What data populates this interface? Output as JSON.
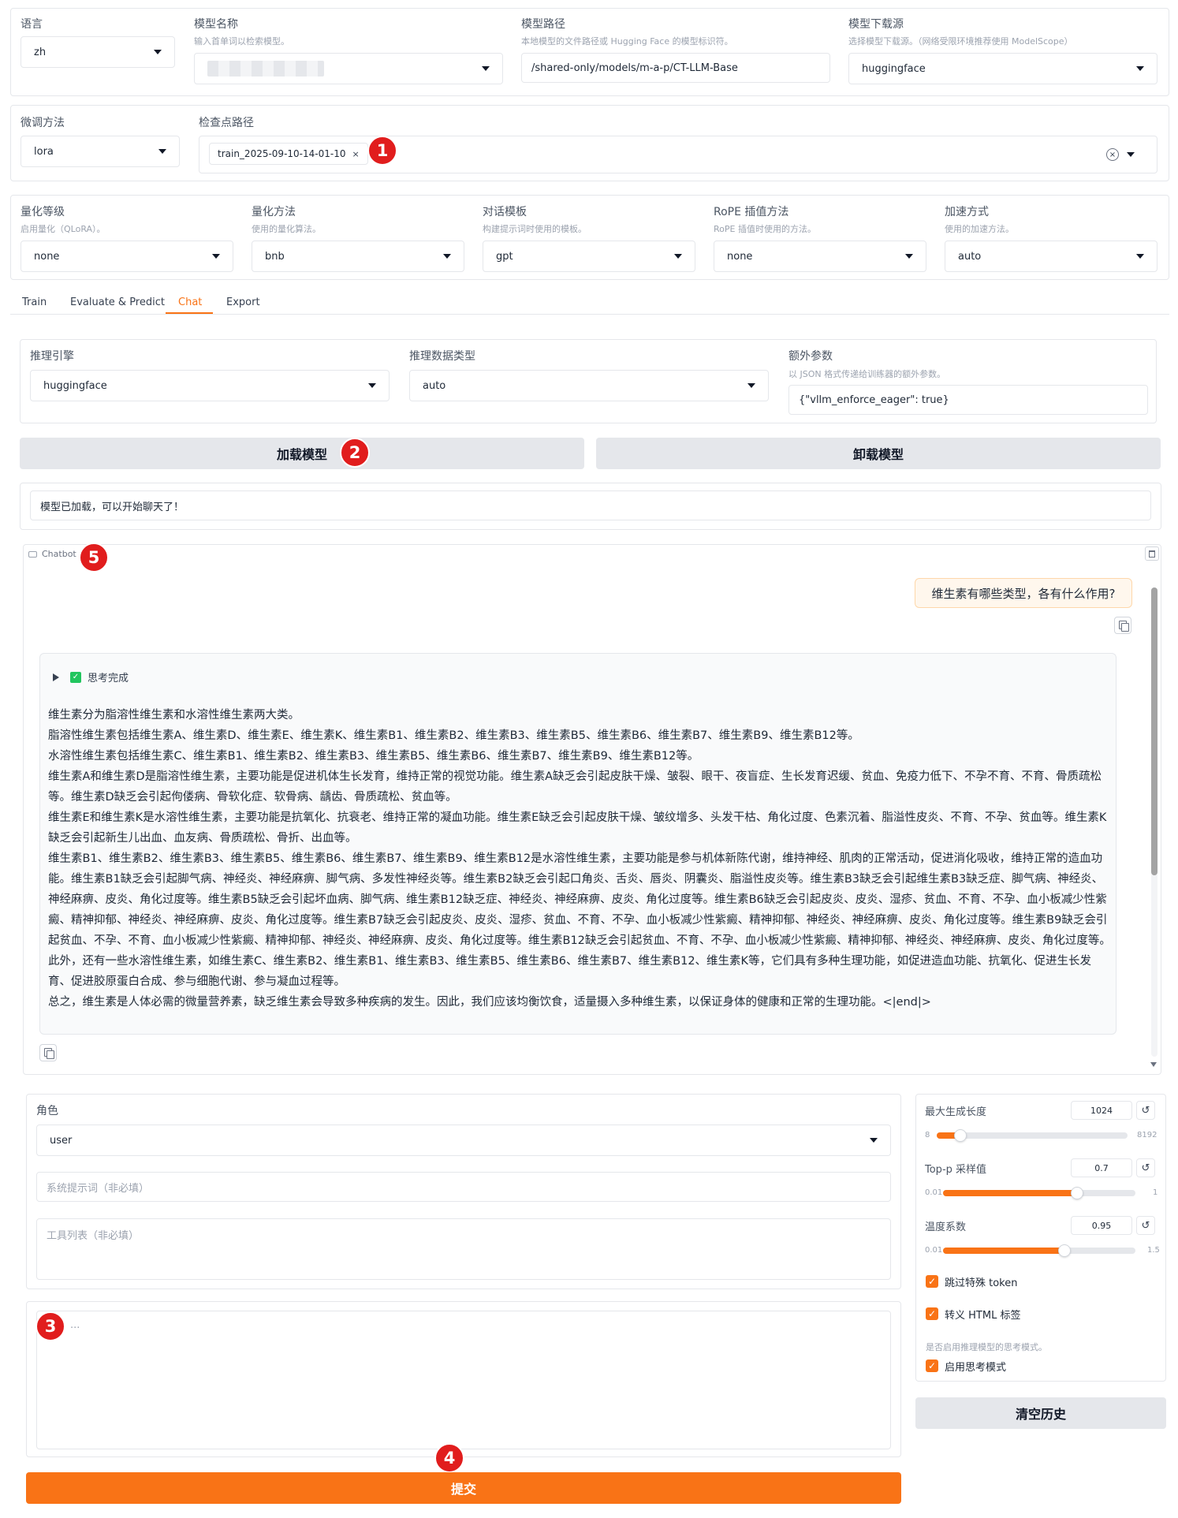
{
  "top": {
    "lang": {
      "label": "语言",
      "value": "zh"
    },
    "model_name": {
      "label": "模型名称",
      "desc": "输入首单词以检索模型。"
    },
    "model_path": {
      "label": "模型路径",
      "desc": "本地模型的文件路径或 Hugging Face 的模型标识符。",
      "value": "/shared-only/models/m-a-p/CT-LLM-Base"
    },
    "hub": {
      "label": "模型下载源",
      "desc": "选择模型下载源。（网络受限环境推荐使用 ModelScope）",
      "value": "huggingface"
    }
  },
  "finetune": {
    "method": {
      "label": "微调方法",
      "value": "lora"
    },
    "checkpoint": {
      "label": "检查点路径",
      "chip": "train_2025-09-10-14-01-10"
    }
  },
  "quant": {
    "level": {
      "label": "量化等级",
      "desc": "启用量化（QLoRA）。",
      "value": "none"
    },
    "method": {
      "label": "量化方法",
      "desc": "使用的量化算法。",
      "value": "bnb"
    },
    "template": {
      "label": "对话模板",
      "desc": "构建提示词时使用的模板。",
      "value": "gpt"
    },
    "rope": {
      "label": "RoPE 插值方法",
      "desc": "RoPE 插值时使用的方法。",
      "value": "none"
    },
    "booster": {
      "label": "加速方式",
      "desc": "使用的加速方法。",
      "value": "auto"
    }
  },
  "tabs": [
    "Train",
    "Evaluate & Predict",
    "Chat",
    "Export"
  ],
  "infer": {
    "backend": {
      "label": "推理引擎",
      "value": "huggingface"
    },
    "dtype": {
      "label": "推理数据类型",
      "value": "auto"
    },
    "extra": {
      "label": "额外参数",
      "desc": "以 JSON 格式传递给训练器的额外参数。",
      "value": "{\"vllm_enforce_eager\": true}"
    }
  },
  "buttons": {
    "load": "加载模型",
    "unload": "卸载模型",
    "submit": "提交",
    "clear": "清空历史"
  },
  "status": "模型已加载，可以开始聊天了！",
  "chatbot": {
    "label": "Chatbot",
    "user_msg": "维生素有哪些类型，各有什么作用?",
    "thinking": "思考完成",
    "answer": [
      "维生素分为脂溶性维生素和水溶性维生素两大类。",
      "脂溶性维生素包括维生素A、维生素D、维生素E、维生素K、维生素B1、维生素B2、维生素B3、维生素B5、维生素B6、维生素B7、维生素B9、维生素B12等。",
      "水溶性维生素包括维生素C、维生素B1、维生素B2、维生素B3、维生素B5、维生素B6、维生素B7、维生素B9、维生素B12等。",
      "维生素A和维生素D是脂溶性维生素，主要功能是促进机体生长发育，维持正常的视觉功能。维生素A缺乏会引起皮肤干燥、皱裂、眼干、夜盲症、生长发育迟缓、贫血、免疫力低下、不孕不育、不育、骨质疏松等。维生素D缺乏会引起佝偻病、骨软化症、软骨病、龋齿、骨质疏松、贫血等。",
      "维生素E和维生素K是水溶性维生素，主要功能是抗氧化、抗衰老、维持正常的凝血功能。维生素E缺乏会引起皮肤干燥、皱纹增多、头发干枯、角化过度、色素沉着、脂溢性皮炎、不育、不孕、贫血等。维生素K缺乏会引起新生儿出血、血友病、骨质疏松、骨折、出血等。",
      "维生素B1、维生素B2、维生素B3、维生素B5、维生素B6、维生素B7、维生素B9、维生素B12是水溶性维生素，主要功能是参与机体新陈代谢，维持神经、肌肉的正常活动，促进消化吸收，维持正常的造血功能。维生素B1缺乏会引起脚气病、神经炎、神经麻痹、脚气病、多发性神经炎等。维生素B2缺乏会引起口角炎、舌炎、唇炎、阴囊炎、脂溢性皮炎等。维生素B3缺乏会引起维生素B3缺乏症、脚气病、神经炎、神经麻痹、皮炎、角化过度等。维生素B5缺乏会引起坏血病、脚气病、维生素B12缺乏症、神经炎、神经麻痹、皮炎、角化过度等。维生素B6缺乏会引起皮炎、皮炎、湿疹、贫血、不育、不孕、血小板减少性紫癜、精神抑郁、神经炎、神经麻痹、皮炎、角化过度等。维生素B7缺乏会引起皮炎、皮炎、湿疹、贫血、不育、不孕、血小板减少性紫癜、精神抑郁、神经炎、神经麻痹、皮炎、角化过度等。维生素B9缺乏会引起贫血、不孕、不育、血小板减少性紫癜、精神抑郁、神经炎、神经麻痹、皮炎、角化过度等。维生素B12缺乏会引起贫血、不育、不孕、血小板减少性紫癜、精神抑郁、神经炎、神经麻痹、皮炎、角化过度等。",
      "此外，还有一些水溶性维生素，如维生素C、维生素B2、维生素B1、维生素B3、维生素B5、维生素B6、维生素B7、维生素B12、维生素K等，它们具有多种生理功能，如促进造血功能、抗氧化、促进生长发育、促进胶原蛋白合成、参与细胞代谢、参与凝血过程等。",
      "总之，维生素是人体必需的微量营养素，缺乏维生素会导致多种疾病的发生。因此，我们应该均衡饮食，适量摄入多种维生素，以保证身体的健康和正常的生理功能。<|end|>"
    ]
  },
  "input": {
    "role": {
      "label": "角色",
      "value": "user"
    },
    "system_ph": "系统提示词（非必填）",
    "tools_ph": "工具列表（非必填）",
    "query_ph": "..."
  },
  "gen": {
    "max_len": {
      "label": "最大生成长度",
      "value": "1024",
      "min": "8",
      "max": "8192",
      "fraction": 0.124
    },
    "top_p": {
      "label": "Top-p 采样值",
      "value": "0.7",
      "min": "0.01",
      "max": "1",
      "fraction": 0.697
    },
    "temp": {
      "label": "温度系数",
      "value": "0.95",
      "min": "0.01",
      "max": "1.5",
      "fraction": 0.631
    },
    "skip": "跳过特殊 token",
    "escape": "转义 HTML 标签",
    "think_desc": "是否启用推理模型的思考模式。",
    "think": "启用思考模式"
  },
  "badges": [
    "1",
    "2",
    "3",
    "4",
    "5"
  ]
}
